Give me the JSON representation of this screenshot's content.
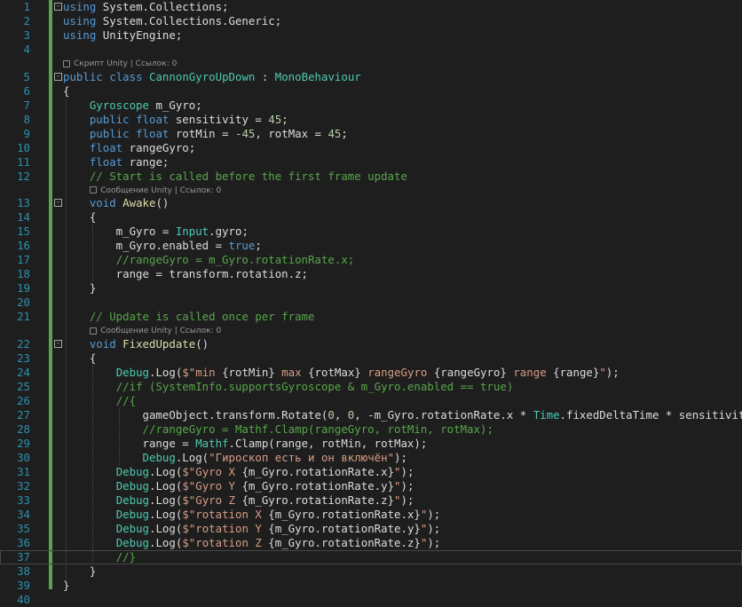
{
  "editor": {
    "language": "csharp",
    "lines": [
      {
        "n": "1",
        "fold": "-",
        "code": [
          [
            "kw",
            "using"
          ],
          [
            "p",
            " System.Collections;"
          ]
        ]
      },
      {
        "n": "2",
        "code": [
          [
            "kw",
            "using"
          ],
          [
            "p",
            " System.Collections.Generic;"
          ]
        ]
      },
      {
        "n": "3",
        "code": [
          [
            "kw",
            "using"
          ],
          [
            "p",
            " UnityEngine;"
          ]
        ]
      },
      {
        "n": "4",
        "code": []
      },
      {
        "n": "5",
        "fold": "-",
        "code": [
          [
            "kw",
            "public"
          ],
          [
            "p",
            " "
          ],
          [
            "kw",
            "class"
          ],
          [
            "p",
            " "
          ],
          [
            "type",
            "CannonGyroUpDown"
          ],
          [
            "p",
            " : "
          ],
          [
            "type",
            "MonoBehaviour"
          ]
        ]
      },
      {
        "n": "6",
        "code": [
          [
            "p",
            "{"
          ]
        ]
      },
      {
        "n": "7",
        "code": [
          [
            "p",
            "    "
          ],
          [
            "type",
            "Gyroscope"
          ],
          [
            "p",
            " m_Gyro;"
          ]
        ]
      },
      {
        "n": "8",
        "code": [
          [
            "p",
            "    "
          ],
          [
            "kw",
            "public"
          ],
          [
            "p",
            " "
          ],
          [
            "kw",
            "float"
          ],
          [
            "p",
            " sensitivity = "
          ],
          [
            "num",
            "45"
          ],
          [
            "p",
            ";"
          ]
        ]
      },
      {
        "n": "9",
        "code": [
          [
            "p",
            "    "
          ],
          [
            "kw",
            "public"
          ],
          [
            "p",
            " "
          ],
          [
            "kw",
            "float"
          ],
          [
            "p",
            " rotMin = "
          ],
          [
            "num",
            "-45"
          ],
          [
            "p",
            ", rotMax = "
          ],
          [
            "num",
            "45"
          ],
          [
            "p",
            ";"
          ]
        ]
      },
      {
        "n": "10",
        "code": [
          [
            "p",
            "    "
          ],
          [
            "kw",
            "float"
          ],
          [
            "p",
            " rangeGyro;"
          ]
        ]
      },
      {
        "n": "11",
        "code": [
          [
            "p",
            "    "
          ],
          [
            "kw",
            "float"
          ],
          [
            "p",
            " range;"
          ]
        ]
      },
      {
        "n": "12",
        "code": [
          [
            "p",
            "    "
          ],
          [
            "cm",
            "// Start is called before the first frame update"
          ]
        ]
      },
      {
        "n": "13",
        "fold": "-",
        "code": [
          [
            "p",
            "    "
          ],
          [
            "kw",
            "void"
          ],
          [
            "p",
            " "
          ],
          [
            "fn",
            "Awake"
          ],
          [
            "p",
            "()"
          ]
        ]
      },
      {
        "n": "14",
        "code": [
          [
            "p",
            "    {"
          ]
        ]
      },
      {
        "n": "15",
        "code": [
          [
            "p",
            "        m_Gyro = "
          ],
          [
            "type",
            "Input"
          ],
          [
            "p",
            ".gyro;"
          ]
        ]
      },
      {
        "n": "16",
        "code": [
          [
            "p",
            "        m_Gyro.enabled = "
          ],
          [
            "kw",
            "true"
          ],
          [
            "p",
            ";"
          ]
        ]
      },
      {
        "n": "17",
        "code": [
          [
            "p",
            "        "
          ],
          [
            "cm",
            "//rangeGyro = m_Gyro.rotationRate.x;"
          ]
        ]
      },
      {
        "n": "18",
        "code": [
          [
            "p",
            "        range = transform.rotation.z;"
          ]
        ]
      },
      {
        "n": "19",
        "code": [
          [
            "p",
            "    }"
          ]
        ]
      },
      {
        "n": "20",
        "code": []
      },
      {
        "n": "21",
        "code": [
          [
            "p",
            "    "
          ],
          [
            "cm",
            "// Update is called once per frame"
          ]
        ]
      },
      {
        "n": "22",
        "fold": "-",
        "code": [
          [
            "p",
            "    "
          ],
          [
            "kw",
            "void"
          ],
          [
            "p",
            " "
          ],
          [
            "fn",
            "FixedUpdate"
          ],
          [
            "p",
            "()"
          ]
        ]
      },
      {
        "n": "23",
        "code": [
          [
            "p",
            "    {"
          ]
        ]
      },
      {
        "n": "24",
        "code": [
          [
            "p",
            "        "
          ],
          [
            "type",
            "Debug"
          ],
          [
            "p",
            ".Log("
          ],
          [
            "str",
            "$\"min "
          ],
          [
            "p",
            "{rotMin}"
          ],
          [
            "str",
            " max "
          ],
          [
            "p",
            "{rotMax}"
          ],
          [
            "str",
            " rangeGyro "
          ],
          [
            "p",
            "{rangeGyro}"
          ],
          [
            "str",
            " range "
          ],
          [
            "p",
            "{range}"
          ],
          [
            "str",
            "\""
          ],
          [
            "p",
            ");"
          ]
        ]
      },
      {
        "n": "25",
        "code": [
          [
            "p",
            "        "
          ],
          [
            "cm",
            "//if (SystemInfo.supportsGyroscope & m_Gyro.enabled == true)"
          ]
        ]
      },
      {
        "n": "26",
        "code": [
          [
            "p",
            "        "
          ],
          [
            "cm",
            "//{"
          ]
        ]
      },
      {
        "n": "27",
        "code": [
          [
            "p",
            "            gameObject.transform.Rotate("
          ],
          [
            "num",
            "0"
          ],
          [
            "p",
            ", "
          ],
          [
            "num",
            "0"
          ],
          [
            "p",
            ", -m_Gyro.rotationRate.x * "
          ],
          [
            "type",
            "Time"
          ],
          [
            "p",
            ".fixedDeltaTime * sensitivity);"
          ]
        ]
      },
      {
        "n": "28",
        "code": [
          [
            "p",
            "            "
          ],
          [
            "cm",
            "//rangeGyro = Mathf.Clamp(rangeGyro, rotMin, rotMax);"
          ]
        ]
      },
      {
        "n": "29",
        "code": [
          [
            "p",
            "            range = "
          ],
          [
            "type",
            "Mathf"
          ],
          [
            "p",
            ".Clamp(range, rotMin, rotMax);"
          ]
        ]
      },
      {
        "n": "30",
        "code": [
          [
            "p",
            "            "
          ],
          [
            "type",
            "Debug"
          ],
          [
            "p",
            ".Log("
          ],
          [
            "str",
            "\"Гироскоп есть и он включён\""
          ],
          [
            "p",
            ");"
          ]
        ]
      },
      {
        "n": "31",
        "code": [
          [
            "p",
            "        "
          ],
          [
            "type",
            "Debug"
          ],
          [
            "p",
            ".Log("
          ],
          [
            "str",
            "$\"Gyro X "
          ],
          [
            "p",
            "{m_Gyro.rotationRate.x}"
          ],
          [
            "str",
            "\""
          ],
          [
            "p",
            ");"
          ]
        ]
      },
      {
        "n": "32",
        "code": [
          [
            "p",
            "        "
          ],
          [
            "type",
            "Debug"
          ],
          [
            "p",
            ".Log("
          ],
          [
            "str",
            "$\"Gyro Y "
          ],
          [
            "p",
            "{m_Gyro.rotationRate.y}"
          ],
          [
            "str",
            "\""
          ],
          [
            "p",
            ");"
          ]
        ]
      },
      {
        "n": "33",
        "code": [
          [
            "p",
            "        "
          ],
          [
            "type",
            "Debug"
          ],
          [
            "p",
            ".Log("
          ],
          [
            "str",
            "$\"Gyro Z "
          ],
          [
            "p",
            "{m_Gyro.rotationRate.z}"
          ],
          [
            "str",
            "\""
          ],
          [
            "p",
            ");"
          ]
        ]
      },
      {
        "n": "34",
        "code": [
          [
            "p",
            "        "
          ],
          [
            "type",
            "Debug"
          ],
          [
            "p",
            ".Log("
          ],
          [
            "str",
            "$\"rotation X "
          ],
          [
            "p",
            "{m_Gyro.rotationRate.x}"
          ],
          [
            "str",
            "\""
          ],
          [
            "p",
            ");"
          ]
        ]
      },
      {
        "n": "35",
        "code": [
          [
            "p",
            "        "
          ],
          [
            "type",
            "Debug"
          ],
          [
            "p",
            ".Log("
          ],
          [
            "str",
            "$\"rotation Y "
          ],
          [
            "p",
            "{m_Gyro.rotationRate.y}"
          ],
          [
            "str",
            "\""
          ],
          [
            "p",
            ");"
          ]
        ]
      },
      {
        "n": "36",
        "code": [
          [
            "p",
            "        "
          ],
          [
            "type",
            "Debug"
          ],
          [
            "p",
            ".Log("
          ],
          [
            "str",
            "$\"rotation Z "
          ],
          [
            "p",
            "{m_Gyro.rotationRate.z}"
          ],
          [
            "str",
            "\""
          ],
          [
            "p",
            ");"
          ]
        ]
      },
      {
        "n": "37",
        "current": true,
        "code": [
          [
            "p",
            "        "
          ],
          [
            "cm",
            "//}"
          ]
        ]
      },
      {
        "n": "38",
        "code": [
          [
            "p",
            "    }"
          ]
        ]
      },
      {
        "n": "39",
        "code": [
          [
            "p",
            "}"
          ]
        ]
      },
      {
        "n": "40",
        "code": []
      }
    ],
    "lenses": [
      {
        "before": "5",
        "text": "Скрипт Unity | Ссылок: 0"
      },
      {
        "before": "13",
        "text": "Сообщение Unity | Ссылок: 0"
      },
      {
        "before": "22",
        "text": "Сообщение Unity | Ссылок: 0"
      }
    ]
  },
  "colors": {
    "background": "#1e1e1e",
    "keyword": "#569cd6",
    "type": "#4ec9b0",
    "string": "#d69d85",
    "comment": "#57a64a",
    "number": "#b5cea8",
    "method": "#dcdcaa",
    "line_number": "#2b91af"
  }
}
